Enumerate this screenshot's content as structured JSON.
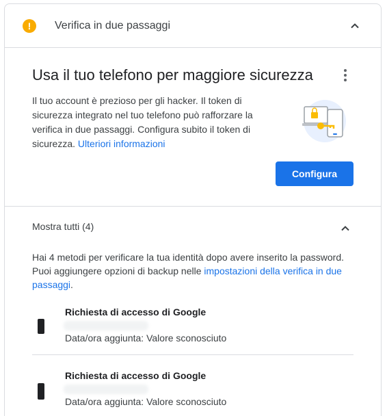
{
  "header": {
    "title": "Verifica in due passaggi",
    "warning_glyph": "!",
    "warning_color": "#f9ab00",
    "warning_icon": "warning-circle-icon",
    "collapse_icon": "chevron-up-icon"
  },
  "security_key": {
    "title": "Usa il tuo telefono per maggiore sicurezza",
    "body": "Il tuo account è prezioso per gli hacker. Il token di sicurezza integrato nel tuo telefono può rafforzare la verifica in due passaggi. Configura subito il token di sicurezza.",
    "learn_more": "Ulteriori informazioni",
    "configure_button": "Configura",
    "menu_icon": "more-vert-icon",
    "accent_color": "#1a73e8"
  },
  "methods_section": {
    "title": "Mostra tutti (4)",
    "collapse_icon": "chevron-up-icon",
    "body_prefix": "Hai 4 metodi per verificare la tua identità dopo avere inserito la password. Puoi aggiungere opzioni di backup nelle",
    "settings_link": "impostazioni della verifica in due passaggi",
    "body_suffix": ".",
    "methods": [
      {
        "title": "Richiesta di accesso di Google",
        "added": "Data/ora aggiunta: Valore sconosciuto",
        "icon": "phone-icon"
      },
      {
        "title": "Richiesta di accesso di Google",
        "added": "Data/ora aggiunta: Valore sconosciuto",
        "icon": "phone-icon"
      }
    ]
  }
}
